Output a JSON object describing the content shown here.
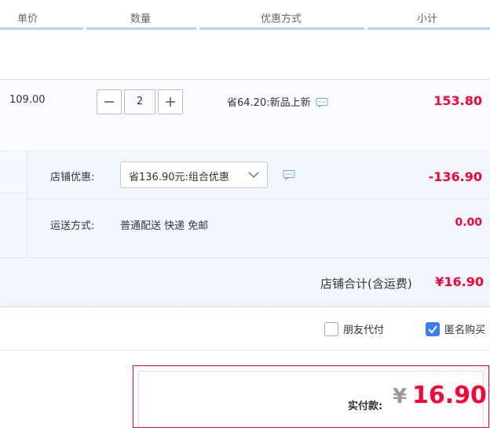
{
  "header": {
    "col_price": "单价",
    "col_qty": "数量",
    "col_promo": "优惠方式",
    "col_subtotal": "小计"
  },
  "item": {
    "unit_price": "109.00",
    "quantity": "2",
    "promo_text": "省64.20:新品上新",
    "subtotal": "153.80"
  },
  "store": {
    "discount_label": "店铺优惠:",
    "discount_select": "省136.90元:组合优惠",
    "discount_amount": "-136.90",
    "shipping_label": "运送方式:",
    "shipping_value": "普通配送 快递 免邮",
    "shipping_amount": "0.00",
    "total_label": "店铺合计(含运费)",
    "total_amount": "¥16.90"
  },
  "options": {
    "friend_pay_label": "朋友代付",
    "friend_pay_checked": false,
    "anonymous_label": "匿名购买",
    "anonymous_checked": true
  },
  "payment": {
    "label": "实付款:",
    "currency": "¥",
    "amount": "16.90"
  },
  "colors": {
    "accent_red": "#ff0036",
    "header_line": "#b2d1ff",
    "checkbox_blue": "#3d7cf0"
  }
}
